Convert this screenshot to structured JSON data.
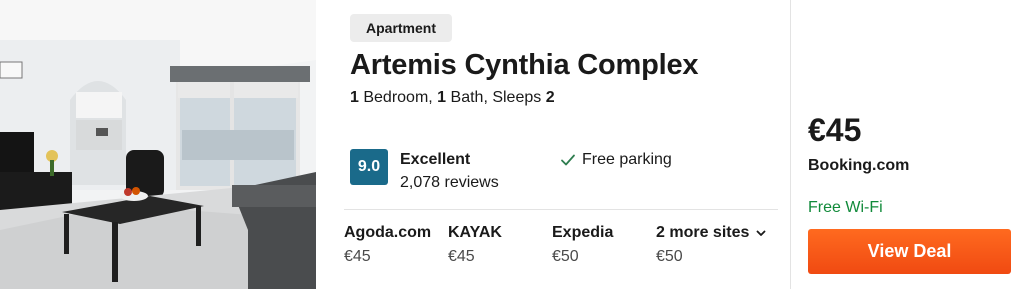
{
  "listing": {
    "type_badge": "Apartment",
    "title": "Artemis Cynthia Complex",
    "specs": {
      "bedrooms": "1",
      "bedroom_label": " Bedroom, ",
      "baths": "1",
      "bath_label": " Bath, Sleeps ",
      "sleeps": "2"
    },
    "rating": {
      "score": "9.0",
      "word": "Excellent",
      "reviews": "2,078 reviews",
      "color": "#1a6a8a"
    },
    "amenity": {
      "label": "Free parking",
      "icon": "check-icon"
    }
  },
  "sites": [
    {
      "name": "Agoda.com",
      "price": "€45"
    },
    {
      "name": "KAYAK",
      "price": "€45"
    },
    {
      "name": "Expedia",
      "price": "€50"
    },
    {
      "name": "2 more sites",
      "price": "€50",
      "icon": "chevron-down-icon"
    }
  ],
  "deal": {
    "price": "€45",
    "provider": "Booking.com",
    "perk": "Free Wi-Fi",
    "button_label": "View Deal",
    "button_color": "#f35a18",
    "perk_color": "#118a3a"
  }
}
